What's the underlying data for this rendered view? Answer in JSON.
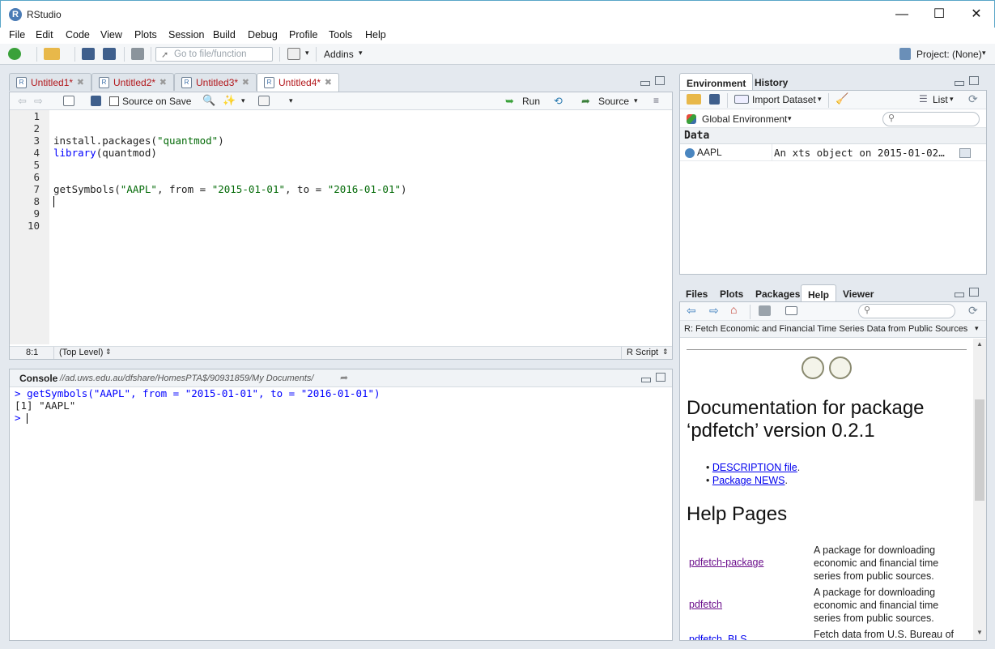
{
  "window": {
    "title": "RStudio",
    "minimize": "—",
    "maximize": "☐",
    "close": "✕"
  },
  "menu": [
    "File",
    "Edit",
    "Code",
    "View",
    "Plots",
    "Session",
    "Build",
    "Debug",
    "Profile",
    "Tools",
    "Help"
  ],
  "toolbar": {
    "goto_placeholder": "Go to file/function",
    "addins": "Addins",
    "project": "Project: (None)"
  },
  "editor": {
    "tabs": [
      "Untitled1*",
      "Untitled2*",
      "Untitled3*",
      "Untitled4*"
    ],
    "active_tab": 3,
    "source_on_save": "Source on Save",
    "run": "Run",
    "source": "Source",
    "line_numbers": [
      "1",
      "2",
      "3",
      "4",
      "5",
      "6",
      "7",
      "8",
      "9",
      "10"
    ],
    "status_pos": "8:1",
    "status_scope": "(Top Level)",
    "status_type": "R Script"
  },
  "console": {
    "title": "Console",
    "path": "//ad.uws.edu.au/dfshare/HomesPTA$/90931859/My Documents/",
    "cmd_prompt": ">",
    "cmd": "getSymbols(\"AAPL\", from = \"2015-01-01\", to = \"2016-01-01\")",
    "output": "[1] \"AAPL\"",
    "prompt": ">"
  },
  "env": {
    "tabs": [
      "Environment",
      "History"
    ],
    "import": "Import Dataset",
    "list": "List",
    "scope": "Global Environment",
    "section": "Data",
    "rows": [
      {
        "name": "AAPL",
        "value": "An xts object on 2015-01-02…"
      }
    ]
  },
  "files": {
    "tabs": [
      "Files",
      "Plots",
      "Packages",
      "Help",
      "Viewer"
    ],
    "help_topic": "R: Fetch Economic and Financial Time Series Data from Public Sources",
    "heading1": "Documentation for package",
    "heading1b": "‘pdfetch’ version 0.2.1",
    "links": [
      "DESCRIPTION file",
      "Package NEWS"
    ],
    "heading2": "Help Pages",
    "pages": [
      {
        "name": "pdfetch-package",
        "desc1": "A package for downloading",
        "desc2": "economic and financial time",
        "desc3": "series from public sources."
      },
      {
        "name": "pdfetch",
        "desc1": "A package for downloading",
        "desc2": "economic and financial time",
        "desc3": "series from public sources."
      },
      {
        "name": "pdfetch_BLS",
        "desc1": "Fetch data from U.S. Bureau of",
        "desc2": "",
        "desc3": ""
      }
    ]
  }
}
